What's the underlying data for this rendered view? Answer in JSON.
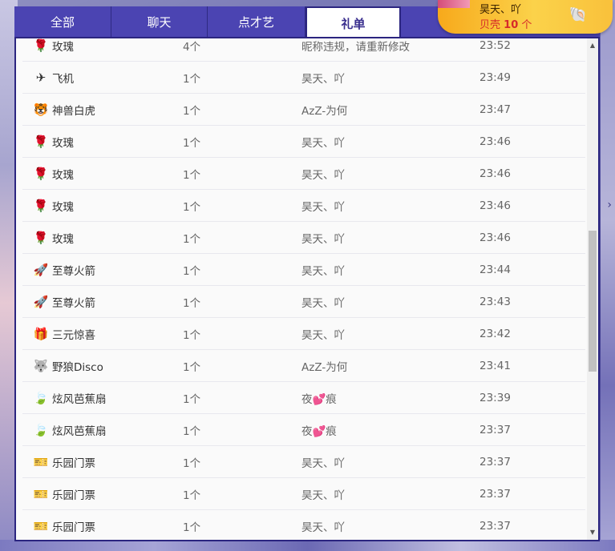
{
  "tabs": [
    {
      "label": "全部"
    },
    {
      "label": "聊天"
    },
    {
      "label": "点才艺"
    },
    {
      "label": "礼单",
      "active": true
    },
    {
      "label": ""
    }
  ],
  "user_card": {
    "name": "昊天、吖",
    "shell_label": "贝壳",
    "shell_count": "10",
    "shell_unit": "个"
  },
  "gifts": [
    {
      "icon": "rose-icon",
      "glyph": "🌹",
      "name": "玫瑰",
      "count": "4个",
      "user": "昵称违规，请重新修改",
      "time": "23:52"
    },
    {
      "icon": "airplane-icon",
      "glyph": "✈",
      "name": "飞机",
      "count": "1个",
      "user": "昊天、吖",
      "time": "23:49"
    },
    {
      "icon": "white-tiger-icon",
      "glyph": "🐯",
      "name": "神兽白虎",
      "count": "1个",
      "user": "AzZ-为何",
      "time": "23:47"
    },
    {
      "icon": "rose-icon",
      "glyph": "🌹",
      "name": "玫瑰",
      "count": "1个",
      "user": "昊天、吖",
      "time": "23:46"
    },
    {
      "icon": "rose-icon",
      "glyph": "🌹",
      "name": "玫瑰",
      "count": "1个",
      "user": "昊天、吖",
      "time": "23:46"
    },
    {
      "icon": "rose-icon",
      "glyph": "🌹",
      "name": "玫瑰",
      "count": "1个",
      "user": "昊天、吖",
      "time": "23:46"
    },
    {
      "icon": "rose-icon",
      "glyph": "🌹",
      "name": "玫瑰",
      "count": "1个",
      "user": "昊天、吖",
      "time": "23:46"
    },
    {
      "icon": "rocket-icon",
      "glyph": "🚀",
      "name": "至尊火箭",
      "count": "1个",
      "user": "昊天、吖",
      "time": "23:44"
    },
    {
      "icon": "rocket-icon",
      "glyph": "🚀",
      "name": "至尊火箭",
      "count": "1个",
      "user": "昊天、吖",
      "time": "23:43"
    },
    {
      "icon": "gift-box-icon",
      "glyph": "🎁",
      "name": "三元惊喜",
      "count": "1个",
      "user": "昊天、吖",
      "time": "23:42"
    },
    {
      "icon": "wolf-disco-icon",
      "glyph": "🐺",
      "name": "野狼Disco",
      "count": "1个",
      "user": "AzZ-为何",
      "time": "23:41"
    },
    {
      "icon": "banana-fan-icon",
      "glyph": "🍃",
      "name": "炫风芭蕉扇",
      "count": "1个",
      "user": "夜💕痕",
      "time": "23:39"
    },
    {
      "icon": "banana-fan-icon",
      "glyph": "🍃",
      "name": "炫风芭蕉扇",
      "count": "1个",
      "user": "夜💕痕",
      "time": "23:37"
    },
    {
      "icon": "ticket-icon",
      "glyph": "🎫",
      "name": "乐园门票",
      "count": "1个",
      "user": "昊天、吖",
      "time": "23:37"
    },
    {
      "icon": "ticket-icon",
      "glyph": "🎫",
      "name": "乐园门票",
      "count": "1个",
      "user": "昊天、吖",
      "time": "23:37"
    },
    {
      "icon": "ticket-icon",
      "glyph": "🎫",
      "name": "乐园门票",
      "count": "1个",
      "user": "昊天、吖",
      "time": "23:37"
    }
  ],
  "scrollbar": {
    "up_icon": "▲",
    "down_icon": "▼"
  },
  "side_arrow": "›"
}
